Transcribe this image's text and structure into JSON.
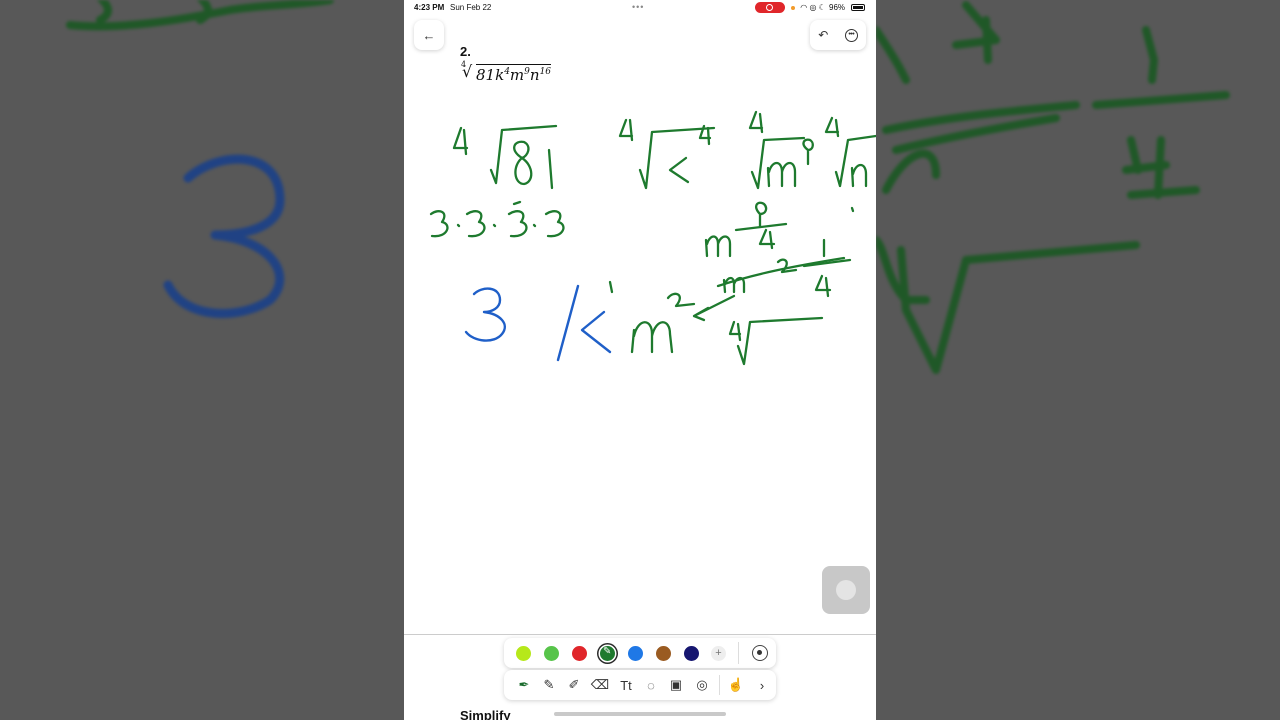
{
  "status_bar": {
    "time": "4:23 PM",
    "date": "Sun Feb 22",
    "battery": "96%"
  },
  "problem": {
    "number": "2.",
    "radical_index": "4",
    "radicand_parts": [
      {
        "base": "81k",
        "exp": "4"
      },
      {
        "base": "m",
        "exp": "9"
      },
      {
        "base": "n",
        "exp": "16"
      }
    ]
  },
  "ink_colors": {
    "green": "#1e7a2e",
    "blue": "#1f5fc8"
  },
  "palette": {
    "colors": [
      "#b6e81a",
      "#57c44a",
      "#e0262a",
      "#1e7a2e",
      "#1f78e6",
      "#9a5b21",
      "#161670"
    ],
    "selected_index": 3
  },
  "icons": {
    "back": "arrow-left-icon",
    "undo": "undo-icon",
    "more": "ellipsis-circle-icon",
    "pen": "pen-icon",
    "pencil": "pencil-icon",
    "highlighter": "highlighter-icon",
    "eraser": "eraser-icon",
    "text": "text-tool-icon",
    "lasso": "lasso-icon",
    "image": "image-icon",
    "shape": "shape-icon",
    "hand": "hand-icon",
    "chevron": "chevron-right-icon"
  },
  "bottom_label": "Simplify"
}
